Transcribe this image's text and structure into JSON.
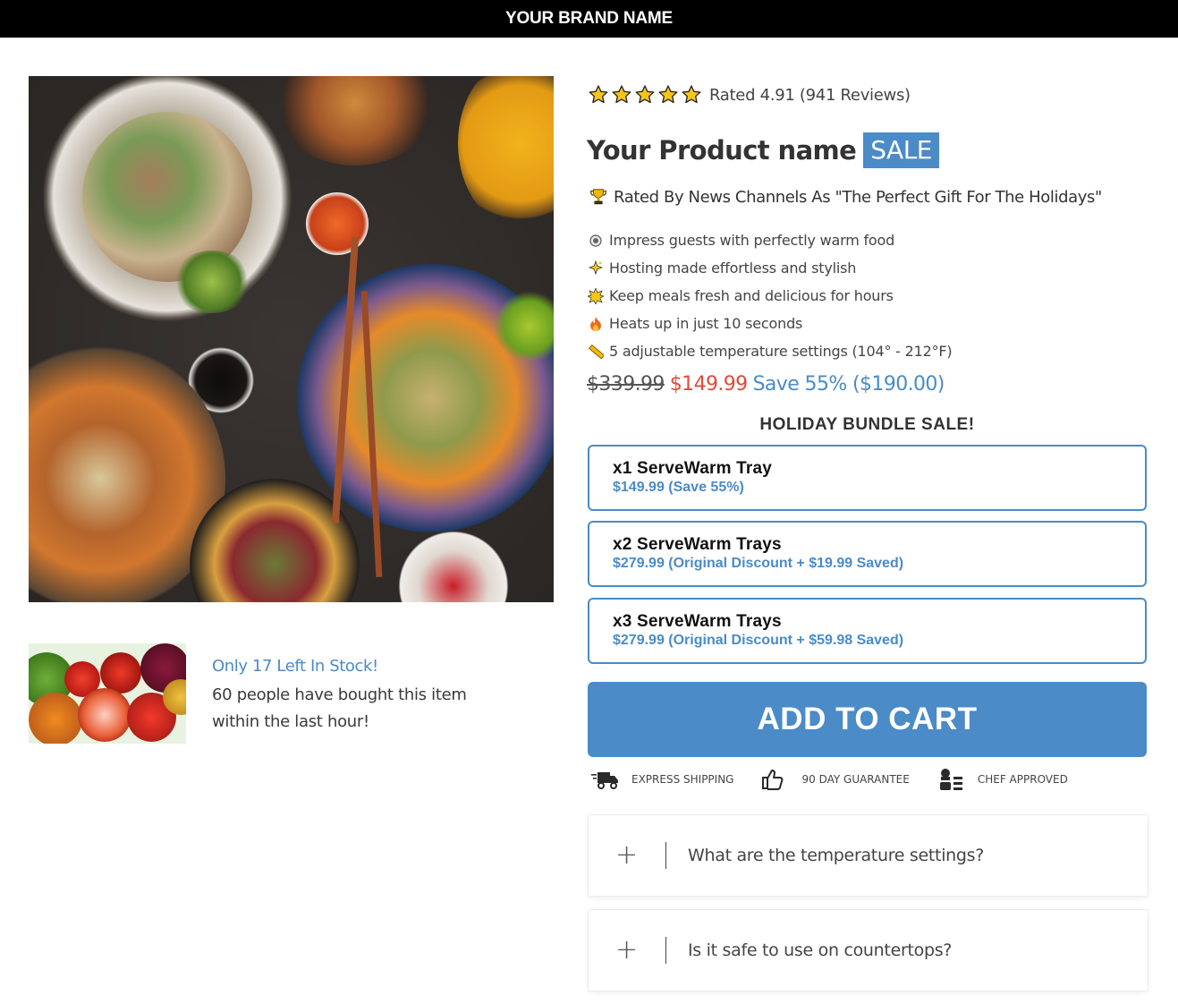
{
  "brand": {
    "name": "YOUR BRAND NAME"
  },
  "rating": {
    "stars": 5,
    "text": "Rated 4.91 (941 Reviews)"
  },
  "product": {
    "name": "Your Product name",
    "badge": "SALE"
  },
  "award": {
    "icon": "trophy-icon",
    "text": "Rated By News Channels As \"The Perfect Gift For The Holidays\""
  },
  "features": [
    {
      "icon": "plate-icon",
      "text": "Impress guests with perfectly warm food"
    },
    {
      "icon": "sparkle-icon",
      "text": "Hosting made effortless and stylish"
    },
    {
      "icon": "burst-icon",
      "text": "Keep meals fresh and delicious for hours"
    },
    {
      "icon": "fire-icon",
      "text": "Heats up in just 10 seconds"
    },
    {
      "icon": "ruler-icon",
      "text": "5 adjustable temperature settings (104° - 212°F)"
    }
  ],
  "price": {
    "original": "$339.99",
    "current": "$149.99",
    "save": "Save 55% ($190.00)"
  },
  "bundle": {
    "heading": "HOLIDAY BUNDLE SALE!",
    "options": [
      {
        "name": "x1 ServeWarm Tray",
        "price": "$149.99 (Save 55%)"
      },
      {
        "name": "x2 ServeWarm Trays",
        "price": "$279.99 (Original Discount + $19.99 Saved)"
      },
      {
        "name": "x3 ServeWarm Trays",
        "price": "$279.99 (Original Discount + $59.98 Saved)"
      }
    ]
  },
  "cta": {
    "label": "ADD TO CART"
  },
  "trust_badges": [
    {
      "icon": "truck-icon",
      "label": "EXPRESS SHIPPING"
    },
    {
      "icon": "thumbs-up-icon",
      "label": "90 DAY GUARANTEE"
    },
    {
      "icon": "chef-icon",
      "label": "CHEF APPROVED"
    }
  ],
  "stock": {
    "title": "Only 17 Left In Stock!",
    "text": "60 people have bought this item within the last hour!"
  },
  "faq": [
    {
      "question": "What are the temperature settings?"
    },
    {
      "question": "Is it safe to use on countertops?"
    }
  ],
  "colors": {
    "accent": "#4a8bc8",
    "sale_price": "#e04a3a",
    "topbar": "#000000"
  }
}
